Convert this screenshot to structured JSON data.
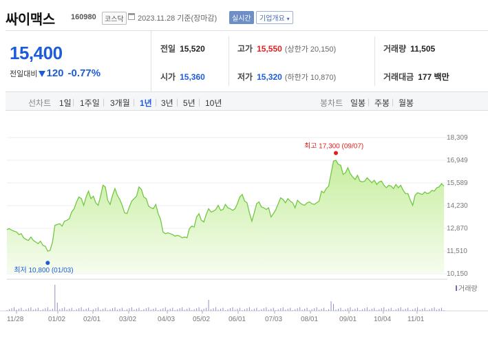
{
  "header": {
    "stock_name": "싸이맥스",
    "stock_code": "160980",
    "market": "코스닥",
    "date_text": "2023.11.28 기준(장마감)",
    "realtime_label": "실시간",
    "corp_info_label": "기업개요",
    "corp_info_caret": "▾"
  },
  "summary": {
    "current_price": "15,400",
    "change_label": "전일대비",
    "change_value": "120",
    "change_percent": "-0.77%",
    "prev_close_label": "전일",
    "prev_close": "15,520",
    "high_label": "고가",
    "high": "15,550",
    "upper_limit": "(상한가 20,150)",
    "volume_label": "거래량",
    "volume": "11,505",
    "open_label": "시가",
    "open": "15,360",
    "low_label": "저가",
    "low": "15,320",
    "lower_limit": "(하한가 10,870)",
    "trade_value_label": "거래대금",
    "trade_value": "177 백만"
  },
  "period_bar": {
    "line_chart_label": "선차트",
    "periods": [
      "1일",
      "1주일",
      "3개월",
      "1년",
      "3년",
      "5년",
      "10년"
    ],
    "selected_period": "1년",
    "candle_chart_label": "봉차트",
    "candle_periods": [
      "일봉",
      "주봉",
      "월봉"
    ]
  },
  "colors": {
    "price_down": "#1d5bd8",
    "price_up": "#e0201f",
    "line": "#72c743",
    "fill_top": "#c6ee9e",
    "fill_bottom": "#f6fcef",
    "volume": "#8d8fc4"
  },
  "chart_data": {
    "type": "area",
    "ylim": [
      10150,
      18309
    ],
    "y_ticks": [
      "18,309",
      "16,949",
      "15,589",
      "14,230",
      "12,870",
      "11,510",
      "10,150"
    ],
    "x_ticks": [
      "11/28",
      "01/02",
      "02/01",
      "03/02",
      "04/03",
      "05/02",
      "06/01",
      "07/03",
      "08/01",
      "09/01",
      "10/04",
      "11/01"
    ],
    "volume_label": "거래량",
    "max_annotation": "최고 17,300 (09/07)",
    "min_annotation": "최저 10,800 (01/03)",
    "prices": [
      12800,
      12850,
      12760,
      12700,
      12650,
      12500,
      12550,
      12300,
      12200,
      12150,
      12350,
      12150,
      12050,
      11950,
      12100,
      11850,
      11800,
      11500,
      11550,
      12050,
      13050,
      13100,
      13150,
      13000,
      13300,
      13350,
      13450,
      13850,
      14050,
      14450,
      14750,
      14650,
      14250,
      14750,
      15100,
      14650,
      14800,
      14400,
      14250,
      14800,
      15450,
      15350,
      14550,
      14300,
      14850,
      15250,
      14850,
      14600,
      14250,
      13800,
      13750,
      14150,
      14500,
      14650,
      14800,
      15350,
      15200,
      14750,
      14650,
      14200,
      14100,
      14050,
      14300,
      13750,
      13400,
      12650,
      12550,
      12600,
      12550,
      12500,
      12400,
      12450,
      12400,
      12300,
      12350,
      12300,
      12850,
      13000,
      12950,
      13550,
      13750,
      13350,
      13250,
      13700,
      14050,
      13850,
      13900,
      14000,
      14250,
      13950,
      14000,
      14300,
      14100,
      14050,
      13950,
      14050,
      14350,
      14750,
      14900,
      14500,
      14400,
      13800,
      13300,
      13800,
      14350,
      14450,
      14150,
      14100,
      14000,
      14100,
      13550,
      13750,
      14000,
      14350,
      14700,
      14600,
      14400,
      14650,
      14500,
      14400,
      14100,
      14550,
      14400,
      14300,
      14250,
      14400,
      14450,
      14350,
      14300,
      14400,
      14500,
      15100,
      15000,
      15250,
      15400,
      16150,
      16900,
      16950,
      16700,
      16650,
      16100,
      16200,
      16500,
      16150,
      15950,
      15800,
      16050,
      15700,
      15650,
      15700,
      15900,
      15750,
      15600,
      15750,
      15500,
      15650,
      15700,
      15450,
      15300,
      15450,
      15400,
      15250,
      15500,
      15300,
      15450,
      15150,
      14950,
      14950,
      14550,
      14250,
      14850,
      15000,
      14950,
      14900,
      15050,
      14950,
      15000,
      15150,
      15100,
      15300,
      15350,
      15550,
      15400
    ],
    "price_dates": "2022-11-28 to 2023-11-28 (daily closes, estimated)",
    "max_point": {
      "date": "09/07",
      "value": 17300
    },
    "min_point": {
      "date": "01/03",
      "value": 10800
    }
  }
}
